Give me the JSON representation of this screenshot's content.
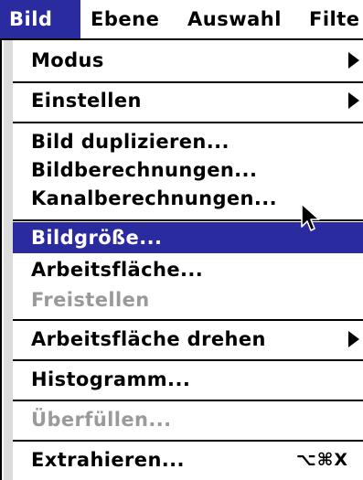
{
  "menubar": {
    "items": [
      {
        "label": "Bild"
      },
      {
        "label": "Ebene"
      },
      {
        "label": "Auswahl"
      },
      {
        "label": "Filte"
      }
    ]
  },
  "menu": {
    "items": [
      {
        "label": "Modus",
        "submenu": true,
        "enabled": true
      },
      {
        "label": "Einstellen",
        "submenu": true,
        "enabled": true
      },
      {
        "label": "Bild duplizieren...",
        "enabled": true
      },
      {
        "label": "Bildberechnungen...",
        "enabled": true
      },
      {
        "label": "Kanalberechnungen...",
        "enabled": true
      },
      {
        "label": "Bildgröße...",
        "enabled": true,
        "highlighted": true
      },
      {
        "label": "Arbeitsfläche...",
        "enabled": true
      },
      {
        "label": "Freistellen",
        "enabled": false
      },
      {
        "label": "Arbeitsfläche drehen",
        "submenu": true,
        "enabled": true
      },
      {
        "label": "Histogramm...",
        "enabled": true
      },
      {
        "label": "Überfüllen...",
        "enabled": false
      },
      {
        "label": "Extrahieren...",
        "enabled": true,
        "shortcut": "⌥⌘X"
      }
    ]
  },
  "colors": {
    "highlight": "#2b2ba0",
    "disabled_text": "#9a9a9a"
  },
  "icons": {
    "cursor": "arrow-cursor-icon",
    "submenu": "submenu-arrow-icon"
  }
}
